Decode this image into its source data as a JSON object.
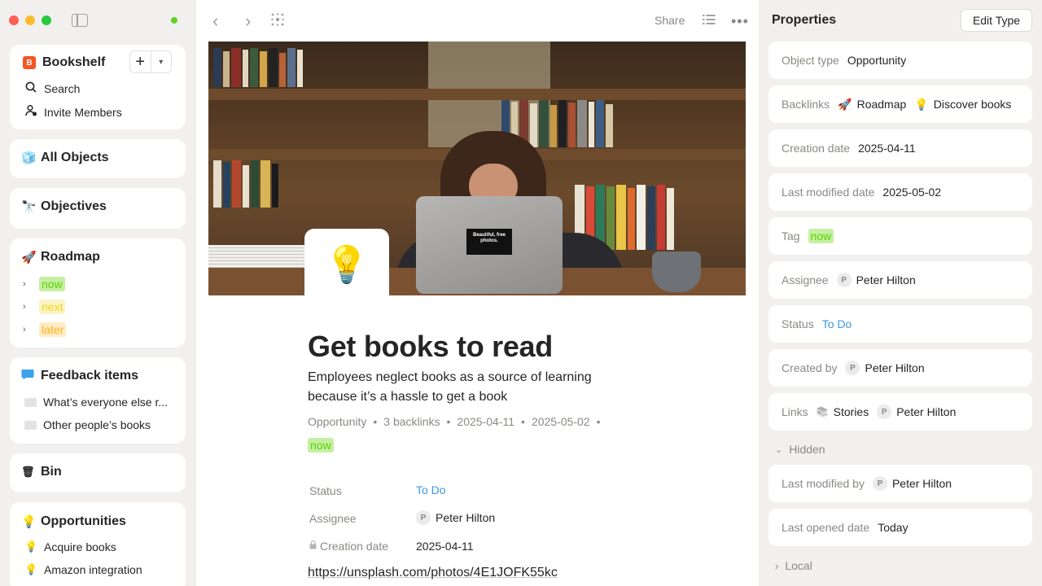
{
  "sidebar": {
    "space": {
      "icon_letter": "B",
      "name": "Bookshelf",
      "add_label": "+",
      "menu_label": "⌄"
    },
    "search_label": "Search",
    "invite_label": "Invite Members",
    "all_objects": {
      "icon": "🧊",
      "label": "All Objects"
    },
    "objectives": {
      "icon": "🔭",
      "label": "Objectives"
    },
    "roadmap": {
      "icon": "🚀",
      "label": "Roadmap",
      "items": [
        {
          "label": "now"
        },
        {
          "label": "next"
        },
        {
          "label": "later"
        }
      ]
    },
    "feedback": {
      "label": "Feedback items",
      "items": [
        {
          "label": "What’s everyone else r..."
        },
        {
          "label": "Other people’s books"
        }
      ]
    },
    "bin": {
      "icon": "🗑",
      "label": "Bin"
    },
    "opportunities": {
      "icon": "💡",
      "label": "Opportunities",
      "items": [
        {
          "icon": "💡",
          "label": "Acquire books"
        },
        {
          "icon": "💡",
          "label": "Amazon integration"
        }
      ]
    }
  },
  "toolbar": {
    "back_icon": "‹",
    "forward_icon": "›",
    "share_label": "Share",
    "more_icon": "•••"
  },
  "object": {
    "icon": "💡",
    "cover_sticker": "Beautiful, free photos.",
    "title": "Get books to read",
    "description": "Employees neglect books as a source of learning because it’s a hassle to get a book",
    "meta": {
      "type": "Opportunity",
      "backlinks": "3 backlinks",
      "created": "2025-04-11",
      "modified": "2025-05-02",
      "separator": "•",
      "tag": "now"
    },
    "relations": [
      {
        "label": "Status",
        "value": "To Do"
      },
      {
        "label": "Assignee",
        "avatar": "P",
        "value": "Peter Hilton"
      },
      {
        "label": "Creation date",
        "value": "2025-04-11"
      }
    ],
    "url": "https://unsplash.com/photos/4E1JOFK55kc"
  },
  "properties": {
    "title": "Properties",
    "edit_type_label": "Edit Type",
    "rows": [
      {
        "label": "Object type",
        "value": "Opportunity"
      },
      {
        "label": "Backlinks",
        "value1_icon": "🚀",
        "value1": "Roadmap",
        "value2_icon": "💡",
        "value2": "Discover books"
      },
      {
        "label": "Creation date",
        "value": "2025-04-11"
      },
      {
        "label": "Last modified date",
        "value": "2025-05-02"
      },
      {
        "label": "Tag",
        "value": "now"
      },
      {
        "label": "Assignee",
        "avatar": "P",
        "value": "Peter Hilton"
      },
      {
        "label": "Status",
        "value": "To Do"
      },
      {
        "label": "Created by",
        "avatar": "P",
        "value": "Peter Hilton"
      },
      {
        "label": "Links",
        "value1_icon": "📚",
        "value1": "Stories",
        "avatar": "P",
        "value2": "Peter Hilton"
      }
    ],
    "hidden_section": {
      "label": "Hidden",
      "rows": [
        {
          "label": "Last modified by",
          "avatar": "P",
          "value": "Peter Hilton"
        },
        {
          "label": "Last opened date",
          "value": "Today"
        }
      ]
    },
    "local_section": {
      "label": "Local"
    }
  },
  "colors": {
    "accent_link": "#3e98e3",
    "tag_now_bg": "#c5efa3",
    "tag_next_bg": "#fef3c5",
    "tag_later_bg": "#ffebc5",
    "space_icon": "#f55522"
  }
}
